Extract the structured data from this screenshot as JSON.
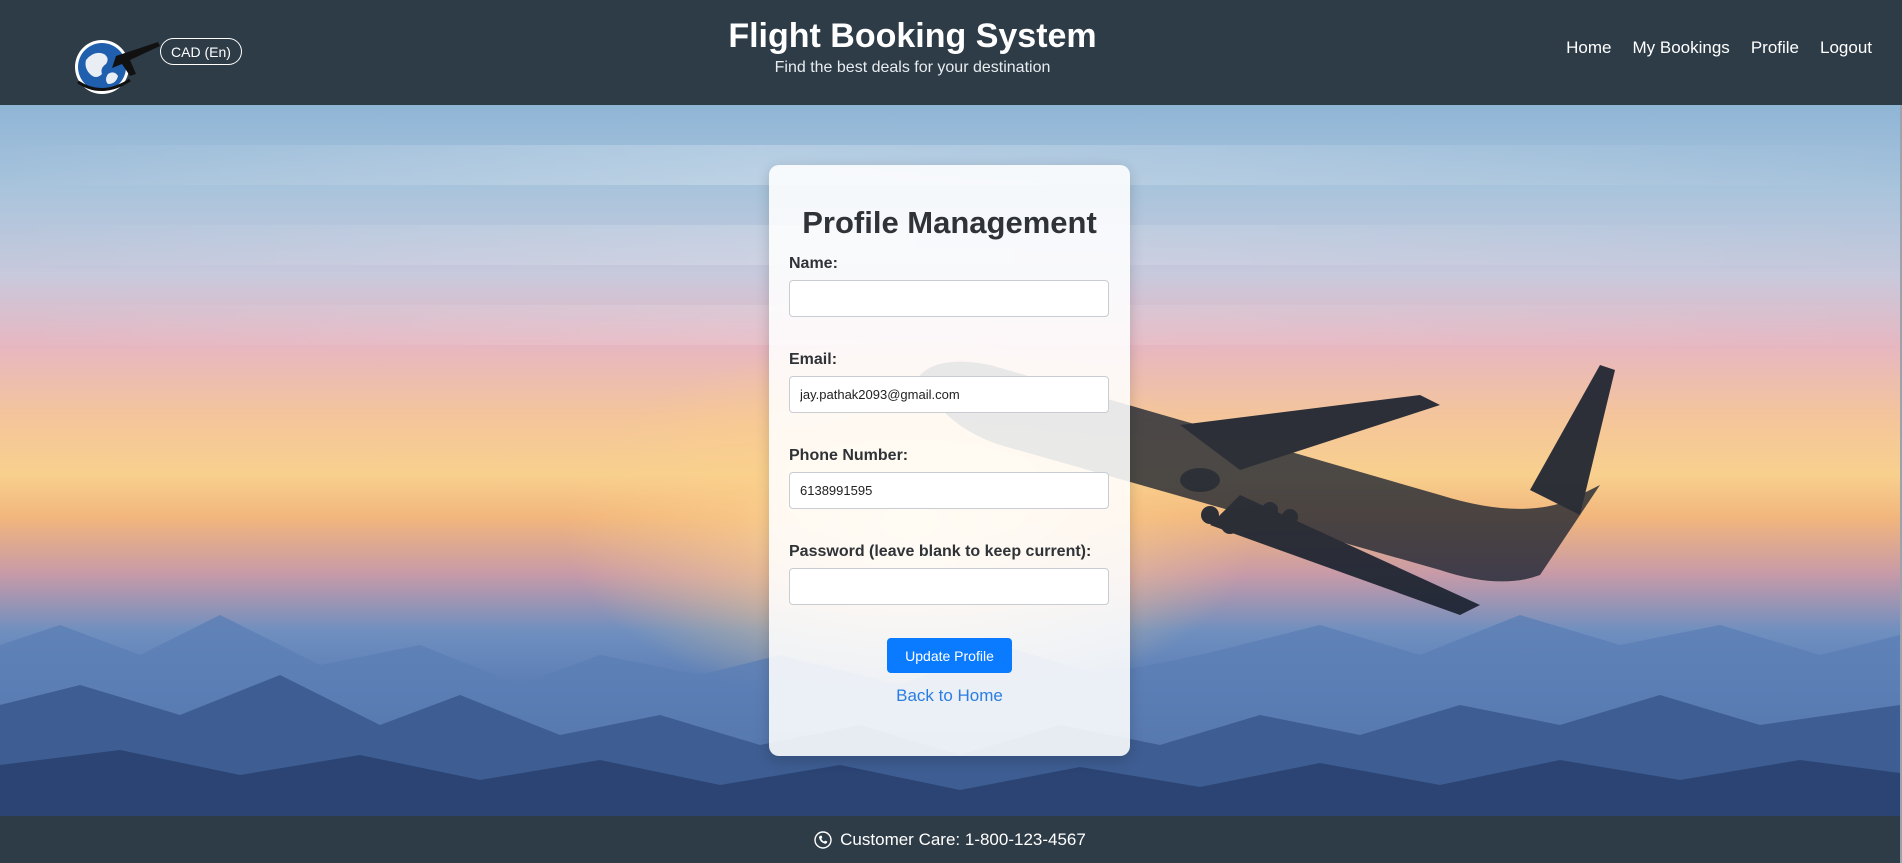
{
  "header": {
    "currency": "CAD (En)",
    "title": "Flight Booking System",
    "subtitle": "Find the best deals for your destination",
    "nav": {
      "home": "Home",
      "bookings": "My Bookings",
      "profile": "Profile",
      "logout": "Logout"
    },
    "logo_icon": "globe-plane-icon"
  },
  "profile_form": {
    "title": "Profile Management",
    "name_label": "Name:",
    "name_value": "",
    "email_label": "Email:",
    "email_value": "jay.pathak2093@gmail.com",
    "phone_label": "Phone Number:",
    "phone_value": "6138991595",
    "password_label": "Password (leave blank to keep current):",
    "password_value": "",
    "submit_label": "Update Profile",
    "back_link": "Back to Home"
  },
  "footer": {
    "icon": "phone-icon",
    "text": "Customer Care: 1-800-123-4567"
  },
  "colors": {
    "header_bg": "#2e3c47",
    "primary_button": "#0a7bff",
    "link": "#2a7de1"
  }
}
